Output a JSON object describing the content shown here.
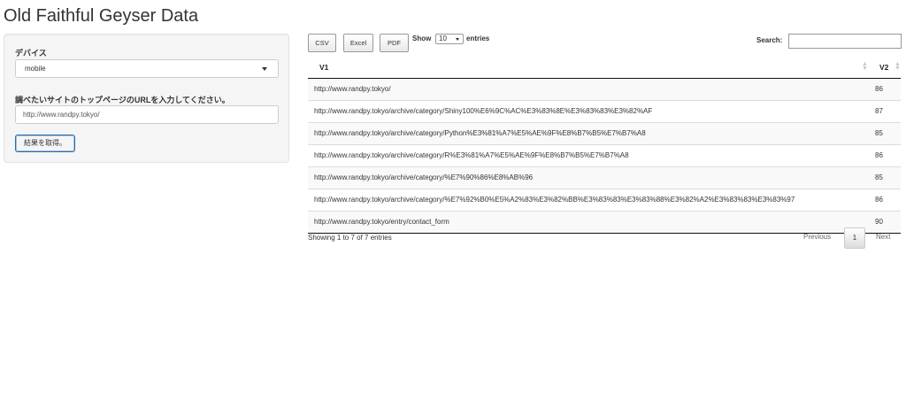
{
  "page": {
    "title": "Old Faithful Geyser Data"
  },
  "sidebar": {
    "device_label": "デバイス",
    "device_value": "mobile",
    "url_label": "調べたいサイトのトップページのURLを入力してください。",
    "url_value": "http://www.randpy.tokyo/",
    "button_label": "結果を取得。"
  },
  "toolbar": {
    "csv": "CSV",
    "excel": "Excel",
    "pdf": "PDF",
    "show": "Show",
    "length_value": "10",
    "entries": "entries",
    "search_label": "Search:",
    "search_value": ""
  },
  "table": {
    "headers": [
      "V1",
      "V2"
    ],
    "rows": [
      {
        "v1": "http://www.randpy.tokyo/",
        "v2": "86"
      },
      {
        "v1": "http://www.randpy.tokyo/archive/category/Shiny100%E6%9C%AC%E3%83%8E%E3%83%83%E3%82%AF",
        "v2": "87"
      },
      {
        "v1": "http://www.randpy.tokyo/archive/category/Python%E3%81%A7%E5%AE%9F%E8%B7%B5%E7%B7%A8",
        "v2": "85"
      },
      {
        "v1": "http://www.randpy.tokyo/archive/category/R%E3%81%A7%E5%AE%9F%E8%B7%B5%E7%B7%A8",
        "v2": "86"
      },
      {
        "v1": "http://www.randpy.tokyo/archive/category/%E7%90%86%E8%AB%96",
        "v2": "85"
      },
      {
        "v1": "http://www.randpy.tokyo/archive/category/%E7%92%B0%E5%A2%83%E3%82%BB%E3%83%83%E3%83%88%E3%82%A2%E3%83%83%E3%83%97",
        "v2": "86"
      },
      {
        "v1": "http://www.randpy.tokyo/entry/contact_form",
        "v2": "90"
      }
    ],
    "info": "Showing 1 to 7 of 7 entries"
  },
  "pagination": {
    "previous": "Previous",
    "page": "1",
    "next": "Next"
  }
}
